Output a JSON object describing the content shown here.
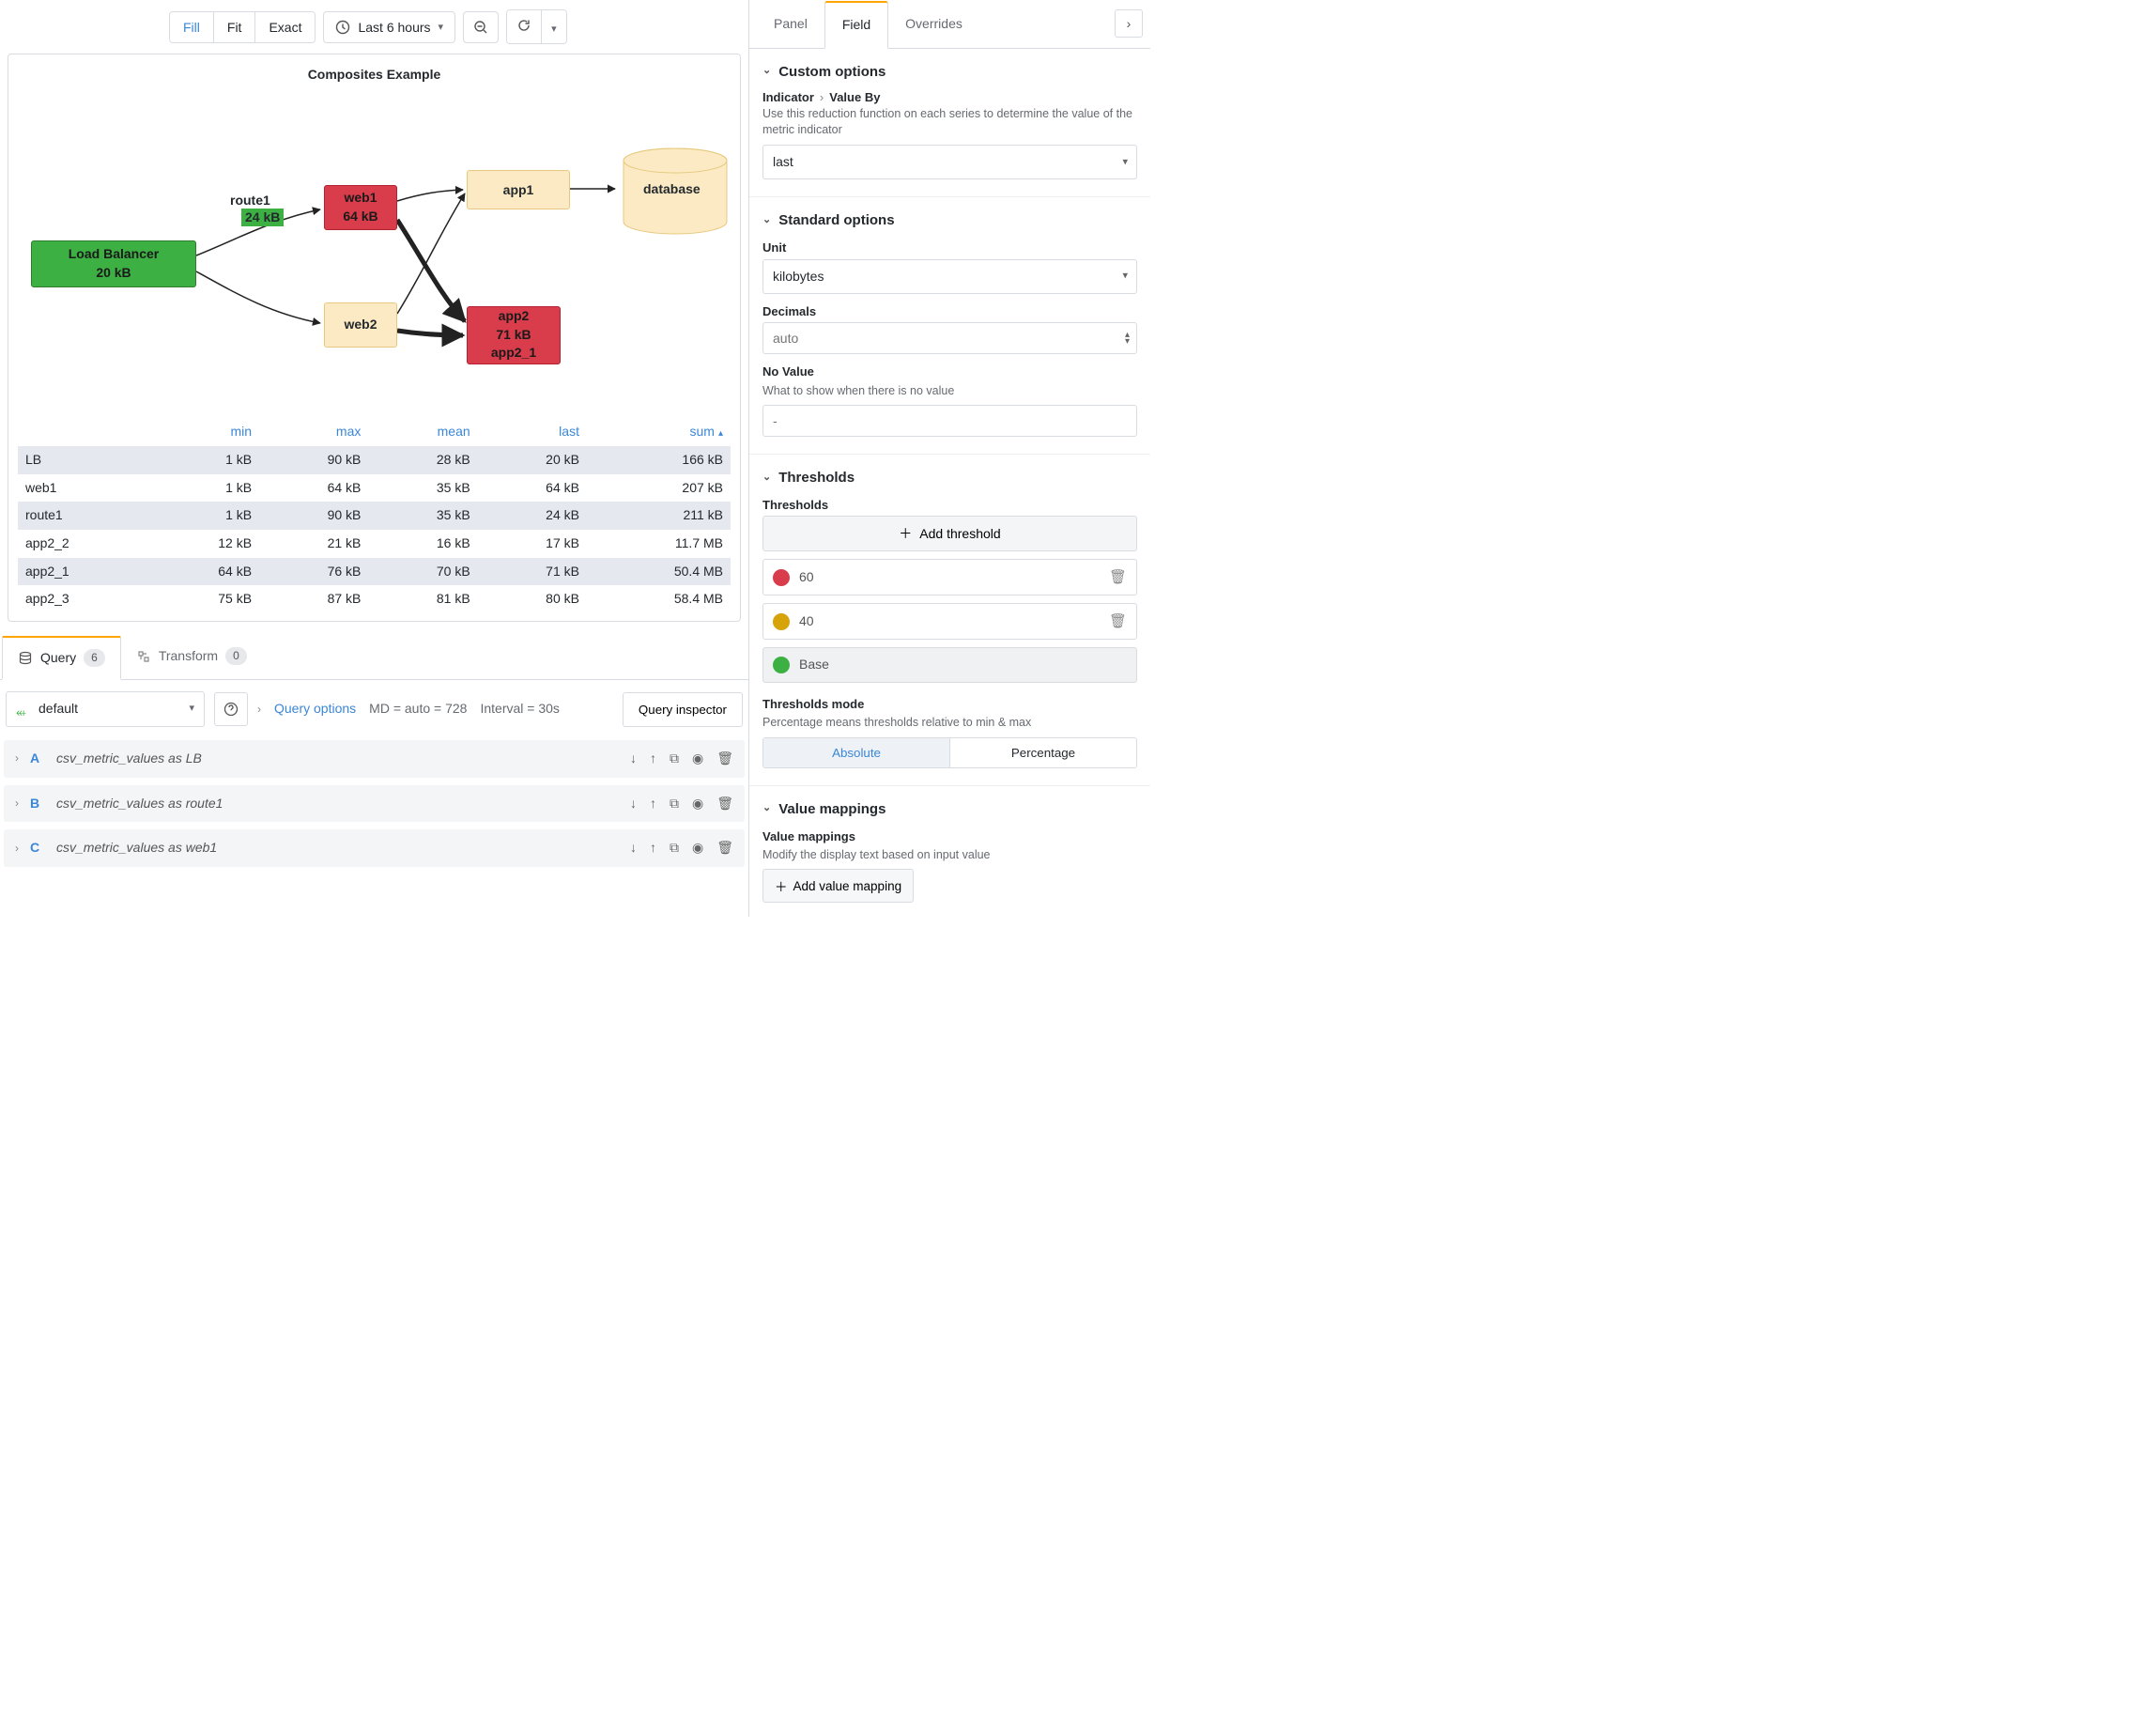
{
  "toolbar": {
    "fit_modes": [
      "Fill",
      "Fit",
      "Exact"
    ],
    "active_fit": 0,
    "time_label": "Last 6 hours"
  },
  "panel": {
    "title": "Composites Example",
    "nodes": {
      "lb": {
        "name": "Load Balancer",
        "value": "20 kB"
      },
      "route1": {
        "name": "route1",
        "value": "24 kB"
      },
      "web1": {
        "name": "web1",
        "value": "64 kB"
      },
      "web2": {
        "name": "web2"
      },
      "app1": {
        "name": "app1"
      },
      "app2": {
        "name": "app2",
        "value": "71 kB",
        "extra": "app2_1"
      },
      "database": {
        "name": "database"
      }
    }
  },
  "table": {
    "headers": [
      "",
      "min",
      "max",
      "mean",
      "last",
      "sum"
    ],
    "sort_col": 5,
    "rows": [
      {
        "name": "LB",
        "min": "1 kB",
        "max": "90 kB",
        "mean": "28 kB",
        "last": "20 kB",
        "sum": "166 kB"
      },
      {
        "name": "web1",
        "min": "1 kB",
        "max": "64 kB",
        "mean": "35 kB",
        "last": "64 kB",
        "sum": "207 kB"
      },
      {
        "name": "route1",
        "min": "1 kB",
        "max": "90 kB",
        "mean": "35 kB",
        "last": "24 kB",
        "sum": "211 kB"
      },
      {
        "name": "app2_2",
        "min": "12 kB",
        "max": "21 kB",
        "mean": "16 kB",
        "last": "17 kB",
        "sum": "11.7 MB"
      },
      {
        "name": "app2_1",
        "min": "64 kB",
        "max": "76 kB",
        "mean": "70 kB",
        "last": "71 kB",
        "sum": "50.4 MB"
      },
      {
        "name": "app2_3",
        "min": "75 kB",
        "max": "87 kB",
        "mean": "81 kB",
        "last": "80 kB",
        "sum": "58.4 MB"
      }
    ]
  },
  "editor_tabs": {
    "query": {
      "label": "Query",
      "count": "6"
    },
    "transform": {
      "label": "Transform",
      "count": "0"
    }
  },
  "query": {
    "datasource": "default",
    "options_label": "Query options",
    "md": "MD = auto = 728",
    "interval": "Interval = 30s",
    "inspector": "Query inspector",
    "items": [
      {
        "ref": "A",
        "name": "csv_metric_values as LB"
      },
      {
        "ref": "B",
        "name": "csv_metric_values as route1"
      },
      {
        "ref": "C",
        "name": "csv_metric_values as web1"
      }
    ]
  },
  "side_tabs": {
    "panel": "Panel",
    "field": "Field",
    "overrides": "Overrides"
  },
  "custom": {
    "title": "Custom options",
    "crumb_a": "Indicator",
    "crumb_b": "Value By",
    "desc": "Use this reduction function on each series to determine the value of the metric indicator",
    "value": "last"
  },
  "standard": {
    "title": "Standard options",
    "unit_label": "Unit",
    "unit_value": "kilobytes",
    "decimals_label": "Decimals",
    "decimals_placeholder": "auto",
    "novalue_label": "No Value",
    "novalue_desc": "What to show when there is no value",
    "novalue_placeholder": "-"
  },
  "thresholds": {
    "title": "Thresholds",
    "sub": "Thresholds",
    "add_label": "Add threshold",
    "entries": [
      {
        "value": "60",
        "color": "#d93c4b"
      },
      {
        "value": "40",
        "color": "#d7a30b"
      }
    ],
    "base_label": "Base",
    "base_color": "#3cb043",
    "mode_label": "Thresholds mode",
    "mode_desc": "Percentage means thresholds relative to min & max",
    "mode_absolute": "Absolute",
    "mode_percentage": "Percentage"
  },
  "mappings": {
    "title": "Value mappings",
    "sub": "Value mappings",
    "desc": "Modify the display text based on input value",
    "add_label": "Add value mapping"
  }
}
